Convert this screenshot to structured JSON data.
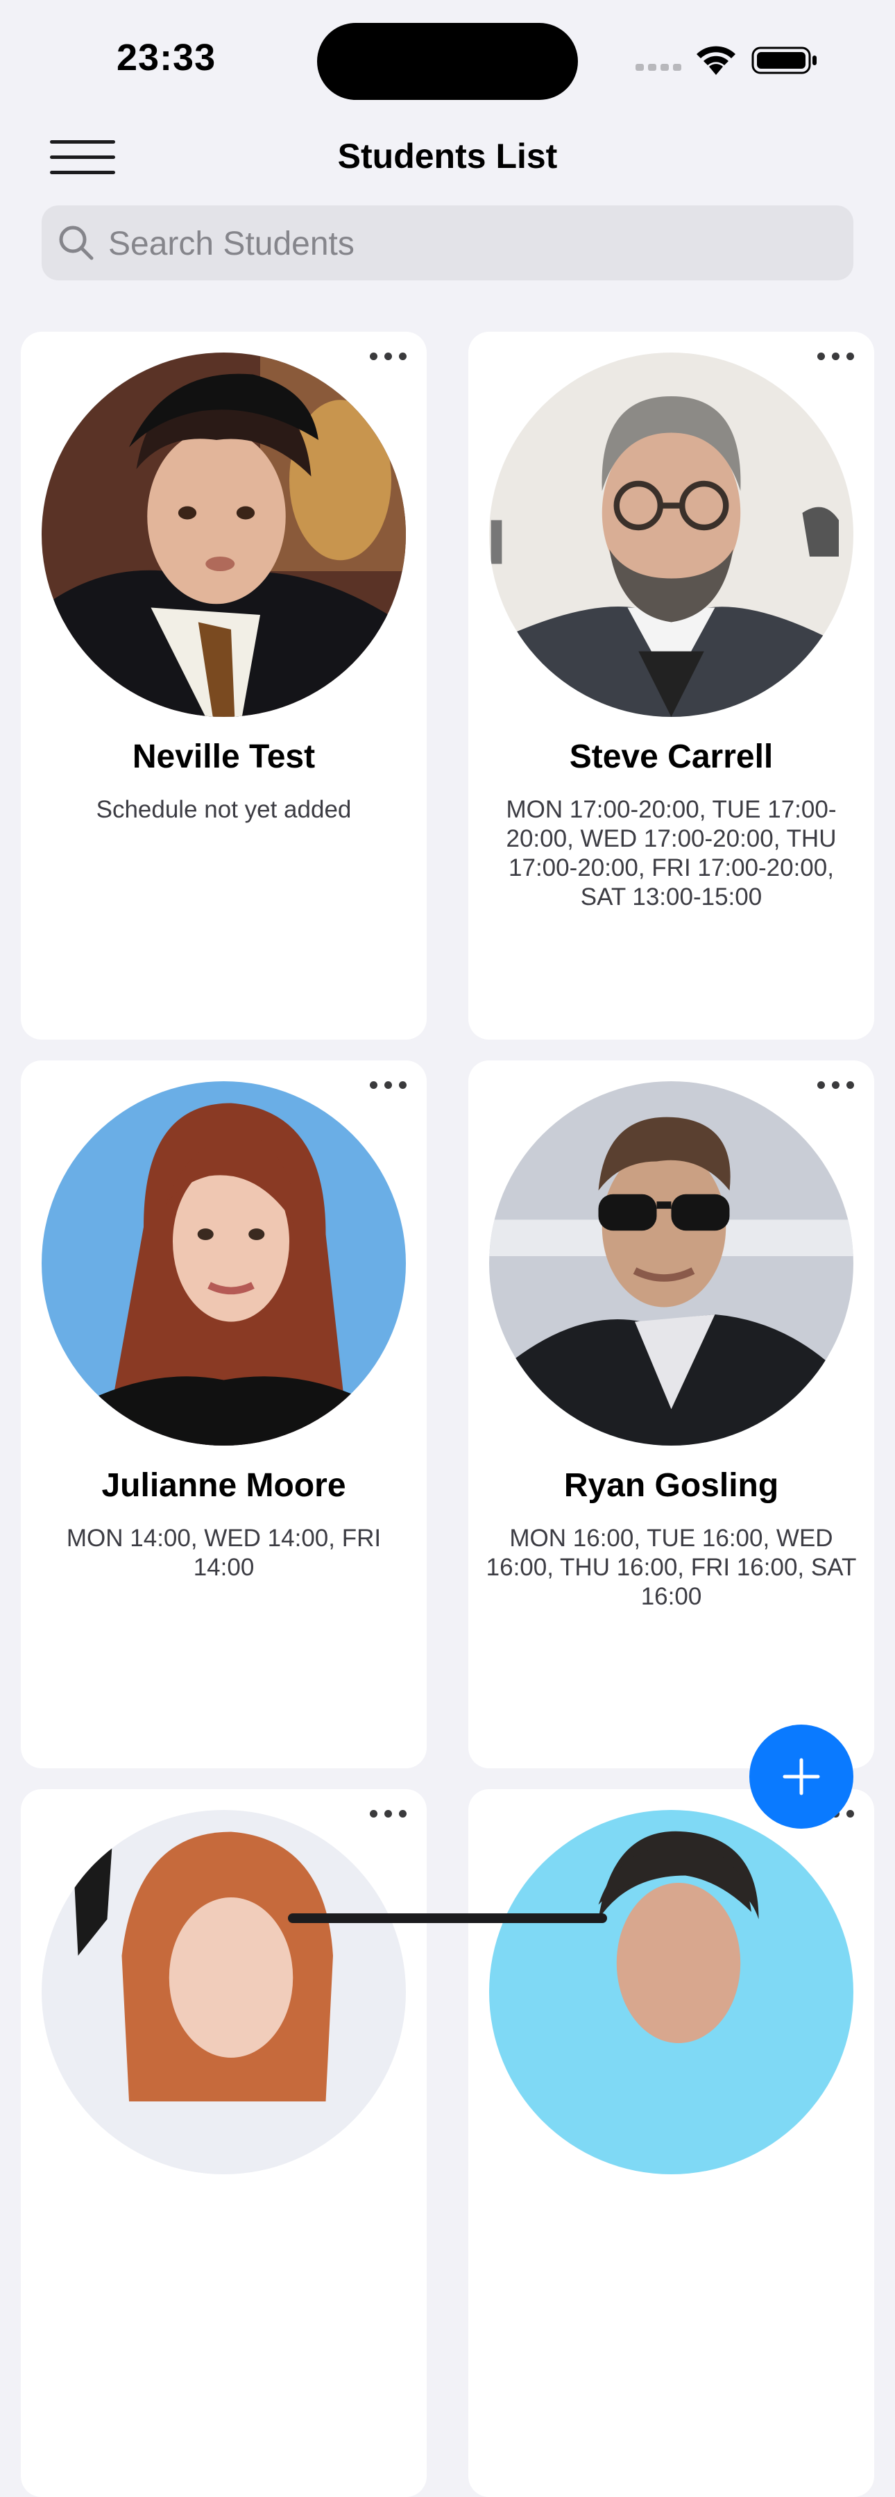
{
  "status_bar": {
    "time": "23:33"
  },
  "nav": {
    "title": "Students List",
    "menu_icon": "hamburger-menu-icon"
  },
  "search": {
    "placeholder": "Search Students",
    "value": "",
    "icon": "search-icon"
  },
  "students": [
    {
      "name": "Neville Test",
      "schedule": "Schedule not yet added",
      "photo_bg": "#6b3a2b"
    },
    {
      "name": "Steve Carrell",
      "schedule": "MON 17:00-20:00, TUE 17:00-20:00, WED 17:00-20:00, THU 17:00-20:00, FRI 17:00-20:00, SAT 13:00-15:00",
      "photo_bg": "#e9e6e1"
    },
    {
      "name": "Julianne Moore",
      "schedule": "MON 14:00, WED 14:00, FRI 14:00",
      "photo_bg": "#6aaee6"
    },
    {
      "name": "Ryan Gosling",
      "schedule": "MON 16:00, TUE 16:00, WED 16:00, THU 16:00, FRI 16:00, SAT 16:00",
      "photo_bg": "#cfd3db"
    },
    {
      "name": "",
      "schedule": "",
      "photo_bg": "#eceef4"
    },
    {
      "name": "",
      "schedule": "",
      "photo_bg": "#7fd9f5"
    }
  ],
  "fab": {
    "icon": "plus-icon",
    "color": "#0a7aff"
  },
  "colors": {
    "background": "#f2f2f7",
    "card": "#ffffff",
    "accent": "#0a7aff"
  }
}
